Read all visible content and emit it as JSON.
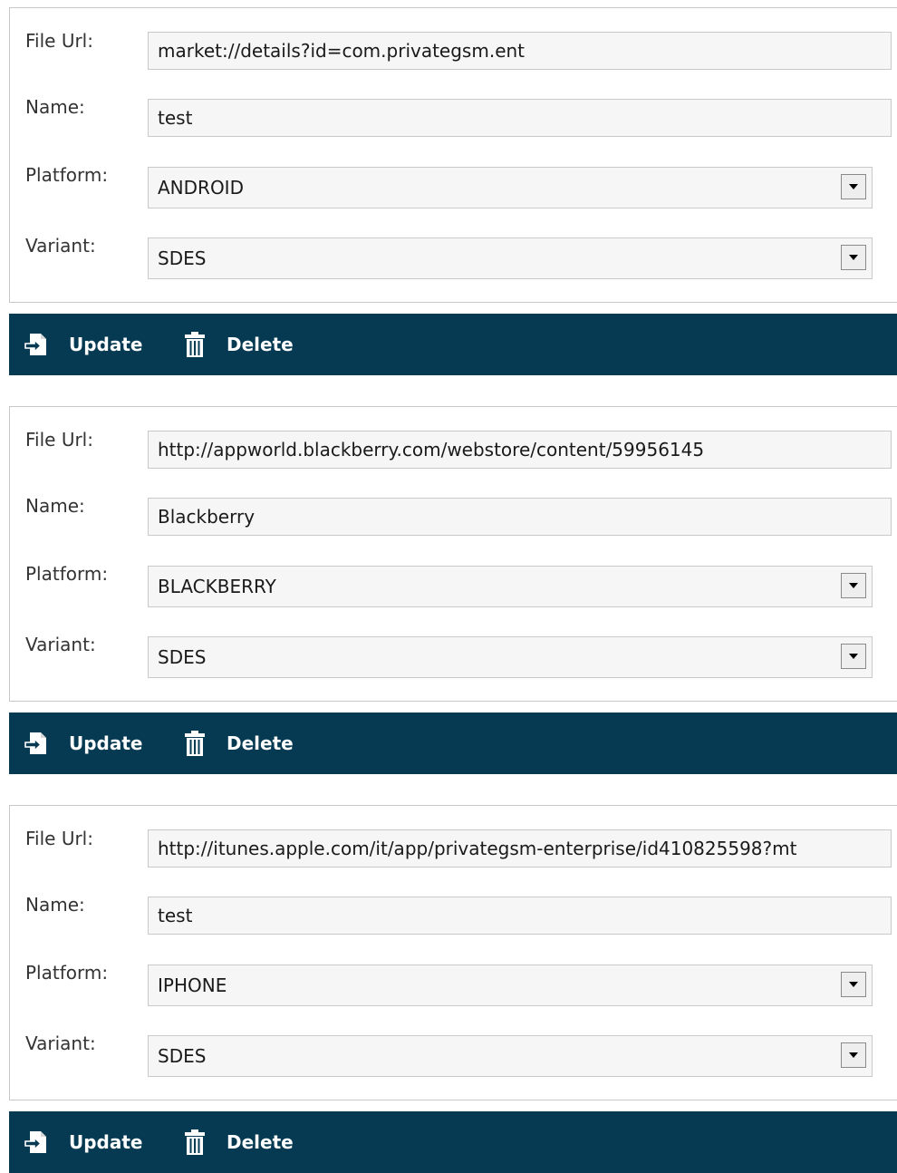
{
  "entries": [
    {
      "file_url_label": "File Url:",
      "file_url": "market://details?id=com.privategsm.ent",
      "name_label": "Name:",
      "name": "test",
      "platform_label": "Platform:",
      "platform": "ANDROID",
      "variant_label": "Variant:",
      "variant": "SDES",
      "update_label": "Update",
      "delete_label": "Delete"
    },
    {
      "file_url_label": "File Url:",
      "file_url": "http://appworld.blackberry.com/webstore/content/59956145",
      "name_label": "Name:",
      "name": "Blackberry",
      "platform_label": "Platform:",
      "platform": "BLACKBERRY",
      "variant_label": "Variant:",
      "variant": "SDES",
      "update_label": "Update",
      "delete_label": "Delete"
    },
    {
      "file_url_label": "File Url:",
      "file_url": "http://itunes.apple.com/it/app/privategsm-enterprise/id410825598?mt",
      "name_label": "Name:",
      "name": "test",
      "platform_label": "Platform:",
      "platform": "IPHONE",
      "variant_label": "Variant:",
      "variant": "SDES",
      "update_label": "Update",
      "delete_label": "Delete"
    }
  ],
  "colors": {
    "action_bar": "#063a52",
    "field_bg": "#f6f6f6",
    "border": "#c9c9c9"
  },
  "icons": {
    "update": "update-icon",
    "delete": "trash-icon",
    "dropdown": "chevron-down-icon"
  }
}
